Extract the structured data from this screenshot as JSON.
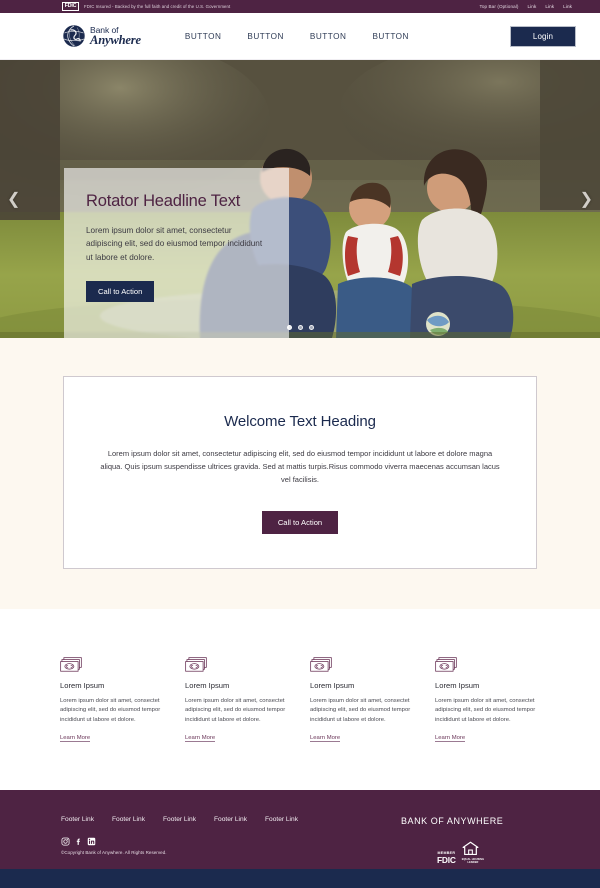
{
  "topbar": {
    "badge": "FDIC",
    "tagline": "FDIC Insured - Backed by the full faith and credit of the U.S. Government",
    "optional_label": "Top Bar (Optional)",
    "links": [
      "Link",
      "Link",
      "Link"
    ],
    "bg_color": "#4e2343"
  },
  "header": {
    "logo": {
      "line1": "Bank of",
      "line2": "Anywhere",
      "icon": "globe-icon"
    },
    "nav": [
      "BUTTON",
      "BUTTON",
      "BUTTON",
      "BUTTON"
    ],
    "login_label": "Login",
    "login_color": "#1b2a4e"
  },
  "hero": {
    "title": "Rotator Headline Text",
    "body": "Lorem ipsum dolor sit amet, consectetur adipiscing elit, sed do eiusmod tempor incididunt ut labore et dolore.",
    "cta_label": "Call to Action",
    "prev_icon": "chevron-left-icon",
    "next_icon": "chevron-right-icon",
    "prev_glyph": "❮",
    "next_glyph": "❯",
    "slides": 3,
    "active_slide": 1
  },
  "welcome": {
    "title": "Welcome Text Heading",
    "body": "Lorem ipsum dolor sit amet, consectetur adipiscing elit, sed do eiusmod tempor incididunt ut labore et dolore magna aliqua. Quis ipsum suspendisse ultrices gravida. Sed at mattis turpis.Risus commodo viverra maecenas accumsan lacus vel facilisis.",
    "cta_label": "Call to Action",
    "cta_color": "#4e2343",
    "bg_color": "#fdf8f0"
  },
  "features": [
    {
      "icon": "money-icon",
      "title": "Lorem Ipsum",
      "body": "Lorem ipsum dolor sit amet, consectet adipiscing elit, sed do eiusmod tempor incididunt ut labore et dolore.",
      "link_label": "Learn More"
    },
    {
      "icon": "money-icon",
      "title": "Lorem Ipsum",
      "body": "Lorem ipsum dolor sit amet, consectet adipiscing elit, sed do eiusmod tempor incididunt ut labore et dolore.",
      "link_label": "Learn More"
    },
    {
      "icon": "money-icon",
      "title": "Lorem Ipsum",
      "body": "Lorem ipsum dolor sit amet, consectet adipiscing elit, sed do eiusmod tempor incididunt ut labore et dolore.",
      "link_label": "Learn More"
    },
    {
      "icon": "money-icon",
      "title": "Lorem Ipsum",
      "body": "Lorem ipsum dolor sit amet, consectet adipiscing elit, sed do eiusmod tempor incididunt ut labore et dolore.",
      "link_label": "Learn More"
    }
  ],
  "footer": {
    "links": [
      "Footer Link",
      "Footer Link",
      "Footer Link",
      "Footer Link",
      "Footer Link"
    ],
    "social": [
      "instagram-icon",
      "facebook-icon",
      "linkedin-icon"
    ],
    "copyright": "©Copyright Bank of Anywhere. All Rights Reserved.",
    "brand": "BANK OF ANYWHERE",
    "fdic_member_line1": "MEMBER",
    "fdic_member_line2": "FDIC",
    "ehl_line1": "EQUAL HOUSING",
    "ehl_line2": "LENDER",
    "bg_color": "#4e2343",
    "strip_color": "#1b2a4e"
  }
}
